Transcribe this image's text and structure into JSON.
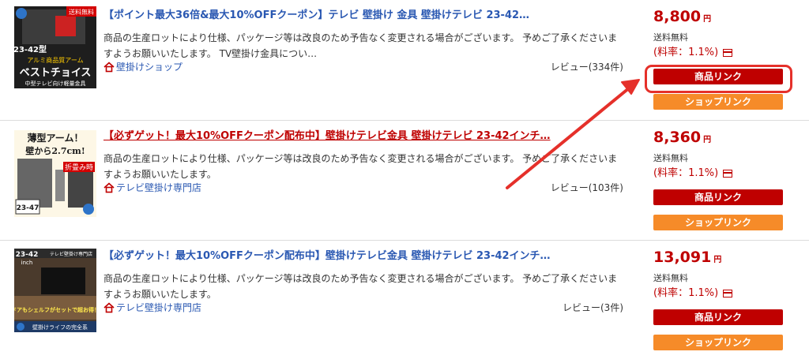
{
  "items": [
    {
      "title": "【ポイント最大36倍&最大10%OFFクーポン】テレビ 壁掛け 金具 壁掛けテレビ 23-42…",
      "description": "商品の生産ロットにより仕様、パッケージ等は改良のため予告なく変更される場合がございます。 予めご了承くださいますようお願いいたします。 TV壁掛け金具につい…",
      "shop": "壁掛けショップ",
      "review": "レビュー(334件)",
      "price": "8,800",
      "yen": "円",
      "shipping": "送料無料",
      "rate": "(料率：1.1%)",
      "product_button": "商品リンク",
      "shop_button": "ショップリンク",
      "thumb_text": [
        "送料無料",
        "23-42型",
        "アルミ商品質アーム",
        "ベストチョイス",
        "中型テレビ向け軽量金具"
      ]
    },
    {
      "title": "【必ずゲット！最大10%OFFクーポン配布中】壁掛けテレビ金具 壁掛けテレビ 23-42インチ…",
      "description": "商品の生産ロットにより仕様、パッケージ等は改良のため予告なく変更される場合がございます。 予めご了承くださいますようお願いいたします。",
      "shop": "テレビ壁掛け専門店",
      "review": "レビュー(103件)",
      "price": "8,360",
      "yen": "円",
      "shipping": "送料無料",
      "rate": "(料率：1.1%)",
      "product_button": "商品リンク",
      "shop_button": "ショップリンク",
      "thumb_text": [
        "薄型アーム！",
        "壁から2.7cm!",
        "折畳み時",
        "23-47"
      ]
    },
    {
      "title": "【必ずゲット！最大10%OFFクーポン配布中】壁掛けテレビ金具 壁掛けテレビ 23-42インチ…",
      "description": "商品の生産ロットにより仕様、パッケージ等は改良のため予告なく変更される場合がございます。 予めご了承くださいますようお願いいたします。",
      "shop": "テレビ壁掛け専門店",
      "review": "レビュー(3件)",
      "price": "13,091",
      "yen": "円",
      "shipping": "送料無料",
      "rate": "(料率：1.1%)",
      "product_button": "商品リンク",
      "shop_button": "ショップリンク",
      "thumb_text": [
        "23-42",
        "inch",
        "テレビ壁掛け専門店",
        "全ドアもシェルフがセットで超お得！！",
        "壁掛けライフの完全系"
      ]
    }
  ],
  "colors": {
    "price_red": "#bf0000",
    "link_blue": "#2a58b2",
    "shop_orange": "#f68b29",
    "annotation_red": "#e5302a"
  }
}
